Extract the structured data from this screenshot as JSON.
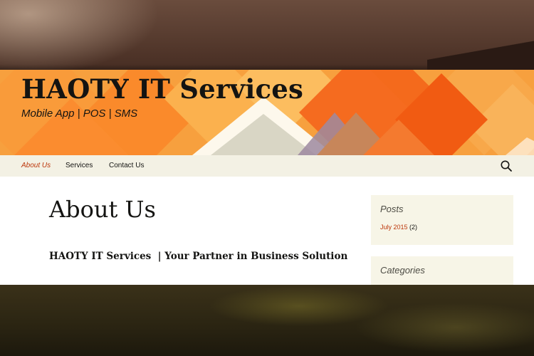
{
  "site": {
    "title": "HAOTY IT Services",
    "tagline": "Mobile App | POS | SMS"
  },
  "nav": {
    "items": [
      {
        "label": "About Us",
        "active": true
      },
      {
        "label": "Services",
        "active": false
      },
      {
        "label": "Contact Us",
        "active": false
      }
    ],
    "search_icon": "search-icon"
  },
  "main": {
    "title": "About Us",
    "subtitle": "HAOTY IT Services  | Your Partner in Business Solution"
  },
  "sidebar": {
    "posts": {
      "title": "Posts",
      "archive_link": "July 2015",
      "archive_count": "(2)"
    },
    "categories": {
      "title": "Categories"
    }
  },
  "colors": {
    "header_orange": "#f7a03e",
    "accent_red": "#bc360a",
    "nav_bg": "#f3f1e4",
    "widget_bg": "#f7f5e7"
  }
}
